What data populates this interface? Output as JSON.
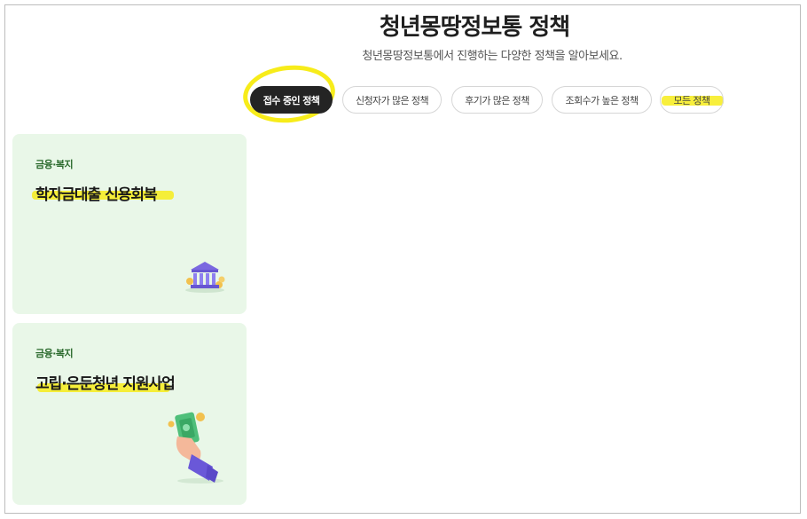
{
  "header": {
    "title": "청년몽땅정보통 정책",
    "subtitle": "청년몽땅정보통에서 진행하는 다양한 정책을 알아보세요."
  },
  "filters": [
    {
      "label": "접수 중인 정책",
      "active": true
    },
    {
      "label": "신청자가 많은 정책",
      "active": false
    },
    {
      "label": "후기가 많은 정책",
      "active": false
    },
    {
      "label": "조회수가 높은 정책",
      "active": false
    },
    {
      "label": "모든 정책",
      "active": false
    }
  ],
  "cards": [
    {
      "category": "금융·복지",
      "title": "학자금대출 신용회복",
      "icon": "bank-icon"
    },
    {
      "category": "금융·복지",
      "title": "고립·은둔청년 지원사업",
      "icon": "money-hand-icon"
    }
  ],
  "colors": {
    "highlight": "#f7ec1a",
    "active_pill": "#242424",
    "card_bg": "#e9f7e8",
    "category_text": "#2b6a2d"
  }
}
